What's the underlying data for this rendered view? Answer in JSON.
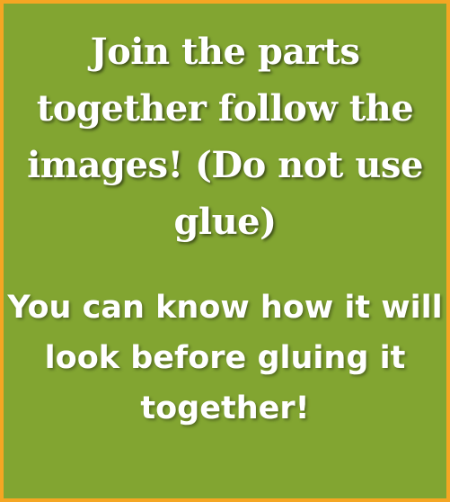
{
  "card": {
    "instruction": "Join the parts together follow the images!  (Do not use glue)",
    "tip": "You can know how it will look before gluing it together!",
    "colors": {
      "background": "#82a531",
      "border": "#f5a623",
      "text": "#ffffff"
    }
  }
}
